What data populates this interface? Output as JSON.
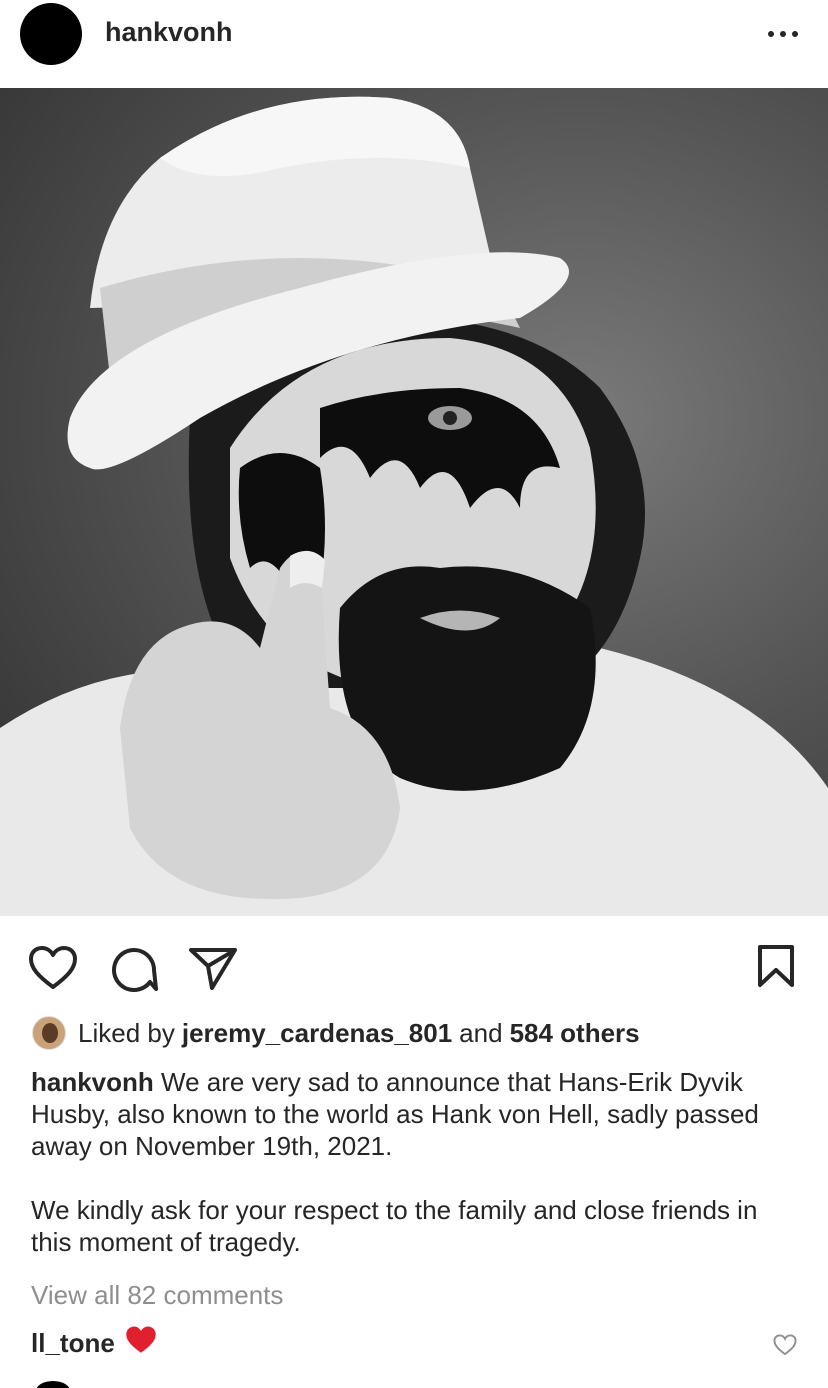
{
  "post": {
    "username": "hankvonh",
    "more_icon": "more-horizontal-icon",
    "photo_alt": "Black and white portrait of man in white top hat with black face paint"
  },
  "actions": {
    "like_icon": "heart-outline-icon",
    "comment_icon": "comment-bubble-icon",
    "share_icon": "paper-plane-icon",
    "save_icon": "bookmark-icon"
  },
  "likes": {
    "prefix": "Liked by",
    "liker": "jeremy_cardenas_801",
    "conjunction": "and",
    "others": "584 others"
  },
  "caption": {
    "username": "hankvonh",
    "paragraph1": "We are very sad to announce that Hans-Erik Dyvik Husby, also known to the world as Hank von Hell, sadly passed away on November 19th, 2021.",
    "paragraph2": "We kindly ask for your respect to the family and close friends in this moment of tragedy."
  },
  "view_all_comments": "View all 82 comments",
  "comments": [
    {
      "username": "ll_tone",
      "text": "❤️"
    }
  ],
  "colors": {
    "text": "#262626",
    "muted": "#8e8e8e",
    "heart_red": "#e0202e"
  }
}
